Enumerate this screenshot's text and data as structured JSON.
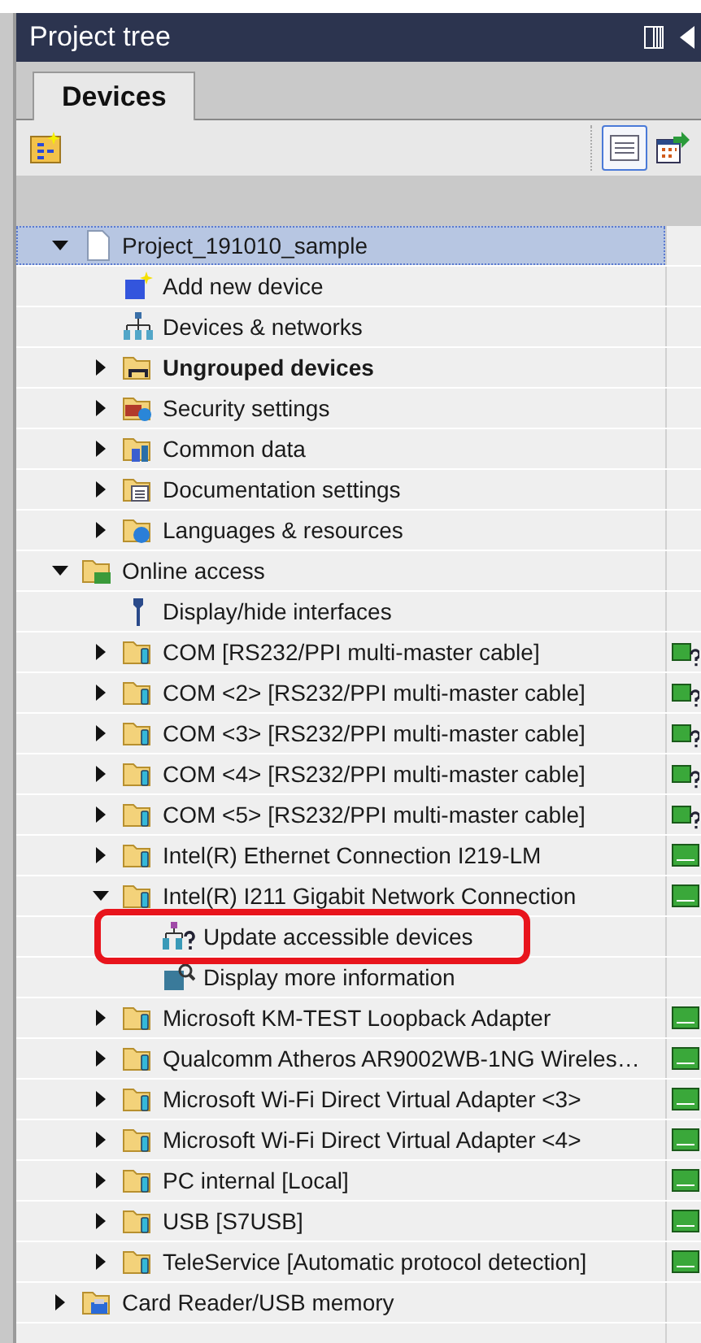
{
  "panel": {
    "title": "Project tree"
  },
  "tabs": [
    {
      "label": "Devices",
      "selected": true
    }
  ],
  "view_toggle": {
    "selected": true
  },
  "tree": {
    "items": [
      {
        "label": "Project_191010_sample",
        "kind": "project",
        "expandable": true,
        "expanded": true,
        "selected": true,
        "bold": false,
        "children": [
          {
            "label": "Add new device",
            "kind": "add-device",
            "expandable": false,
            "selected": false,
            "bold": false
          },
          {
            "label": "Devices & networks",
            "kind": "network",
            "expandable": false,
            "selected": false,
            "bold": false
          },
          {
            "label": "Ungrouped devices",
            "kind": "ungrouped",
            "expandable": true,
            "expanded": false,
            "selected": false,
            "bold": true
          },
          {
            "label": "Security settings",
            "kind": "security",
            "expandable": true,
            "expanded": false,
            "selected": false,
            "bold": false
          },
          {
            "label": "Common data",
            "kind": "common",
            "expandable": true,
            "expanded": false,
            "selected": false,
            "bold": false
          },
          {
            "label": "Documentation settings",
            "kind": "documentation",
            "expandable": true,
            "expanded": false,
            "selected": false,
            "bold": false
          },
          {
            "label": "Languages & resources",
            "kind": "languages",
            "expandable": true,
            "expanded": false,
            "selected": false,
            "bold": false
          }
        ]
      },
      {
        "label": "Online access",
        "kind": "online",
        "expandable": true,
        "expanded": true,
        "selected": false,
        "bold": false,
        "children": [
          {
            "label": "Display/hide interfaces",
            "kind": "wrench",
            "expandable": false,
            "selected": false,
            "bold": false
          },
          {
            "label": "COM [RS232/PPI multi-master cable]",
            "kind": "interface",
            "expandable": true,
            "expanded": false,
            "selected": false,
            "bold": false,
            "status_unknown": true
          },
          {
            "label": "COM <2> [RS232/PPI multi-master cable]",
            "kind": "interface",
            "expandable": true,
            "expanded": false,
            "selected": false,
            "bold": false,
            "status_unknown": true
          },
          {
            "label": "COM <3> [RS232/PPI multi-master cable]",
            "kind": "interface",
            "expandable": true,
            "expanded": false,
            "selected": false,
            "bold": false,
            "status_unknown": true
          },
          {
            "label": "COM <4> [RS232/PPI multi-master cable]",
            "kind": "interface",
            "expandable": true,
            "expanded": false,
            "selected": false,
            "bold": false,
            "status_unknown": true
          },
          {
            "label": "COM <5> [RS232/PPI multi-master cable]",
            "kind": "interface",
            "expandable": true,
            "expanded": false,
            "selected": false,
            "bold": false,
            "status_unknown": true
          },
          {
            "label": "Intel(R) Ethernet Connection I219-LM",
            "kind": "interface",
            "expandable": true,
            "expanded": false,
            "selected": false,
            "bold": false,
            "status_unknown": false
          },
          {
            "label": "Intel(R) I211 Gigabit Network Connection",
            "kind": "interface",
            "expandable": true,
            "expanded": true,
            "selected": false,
            "bold": false,
            "status_unknown": false,
            "children": [
              {
                "label": "Update accessible devices",
                "kind": "update",
                "expandable": false,
                "selected": false,
                "bold": false,
                "highlighted": true
              },
              {
                "label": "Display more information",
                "kind": "info",
                "expandable": false,
                "selected": false,
                "bold": false
              }
            ]
          },
          {
            "label": "Microsoft KM-TEST Loopback Adapter",
            "kind": "interface",
            "expandable": true,
            "expanded": false,
            "selected": false,
            "bold": false,
            "status_unknown": false
          },
          {
            "label": "Qualcomm Atheros AR9002WB-1NG Wireles…",
            "kind": "interface",
            "expandable": true,
            "expanded": false,
            "selected": false,
            "bold": false,
            "status_unknown": false
          },
          {
            "label": "Microsoft Wi-Fi Direct Virtual Adapter <3>",
            "kind": "interface",
            "expandable": true,
            "expanded": false,
            "selected": false,
            "bold": false,
            "status_unknown": false
          },
          {
            "label": "Microsoft Wi-Fi Direct Virtual Adapter <4>",
            "kind": "interface",
            "expandable": true,
            "expanded": false,
            "selected": false,
            "bold": false,
            "status_unknown": false
          },
          {
            "label": "PC internal [Local]",
            "kind": "interface",
            "expandable": true,
            "expanded": false,
            "selected": false,
            "bold": false,
            "status_unknown": false
          },
          {
            "label": "USB [S7USB]",
            "kind": "interface",
            "expandable": true,
            "expanded": false,
            "selected": false,
            "bold": false,
            "status_unknown": false
          },
          {
            "label": "TeleService [Automatic protocol detection]",
            "kind": "interface",
            "expandable": true,
            "expanded": false,
            "selected": false,
            "bold": false,
            "status_unknown": false
          }
        ]
      },
      {
        "label": "Card Reader/USB memory",
        "kind": "card-reader",
        "expandable": true,
        "expanded": false,
        "selected": false,
        "bold": false
      }
    ]
  }
}
